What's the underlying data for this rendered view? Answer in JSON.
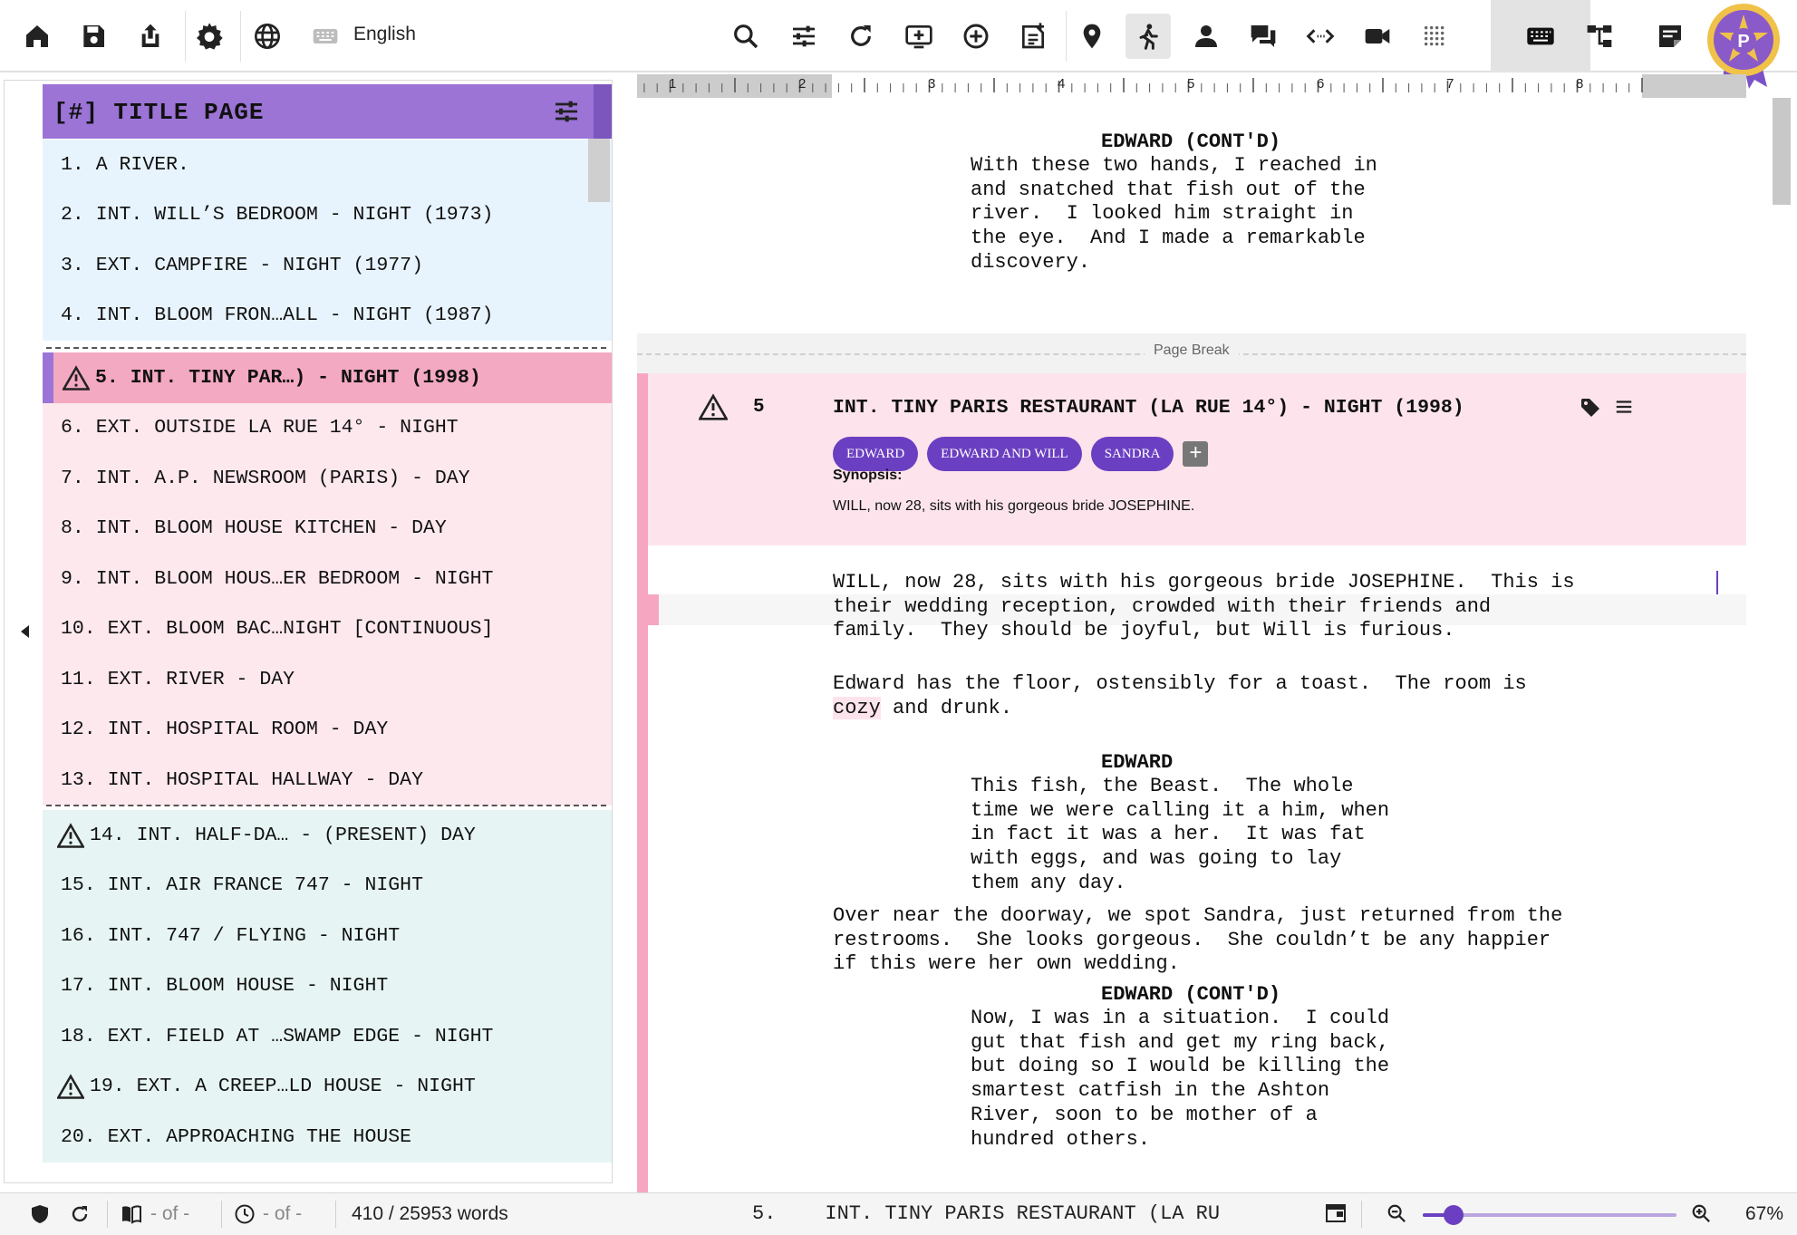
{
  "toolbar": {
    "language": "English",
    "icons": [
      "home-icon",
      "save-icon",
      "export-icon",
      "gear-icon",
      "globe-icon",
      "keyboard-small-icon",
      "search-icon",
      "sliders-icon",
      "refresh-icon",
      "add-scene-icon",
      "add-circle-icon",
      "add-note-icon",
      "location-pin-icon",
      "walking-figure-icon",
      "person-icon",
      "chat-icon",
      "code-arrows-icon",
      "video-camera-icon",
      "dot-grid-icon",
      "keyboard-icon",
      "tree-structure-icon",
      "sticky-note-icon"
    ],
    "avatar_letter": "P",
    "accent_color": "#9b74d6"
  },
  "navigator": {
    "title": "[#] TITLE PAGE",
    "groups": [
      {
        "color": "#e8f4fd",
        "scenes": [
          {
            "label": "1. A RIVER.",
            "warn": false
          },
          {
            "label": "2. INT. WILL’S BEDROOM - NIGHT (1973)",
            "warn": false
          },
          {
            "label": "3. EXT. CAMPFIRE - NIGHT (1977)",
            "warn": false
          },
          {
            "label": "4. INT. BLOOM FRON…ALL - NIGHT (1987)",
            "warn": false
          }
        ]
      },
      {
        "color": "#fde8ee",
        "scenes": [
          {
            "label": "5. INT. TINY PAR…) - NIGHT (1998)",
            "warn": true,
            "selected": true
          },
          {
            "label": "6. EXT. OUTSIDE LA RUE 14° - NIGHT",
            "warn": false
          },
          {
            "label": "7. INT. A.P. NEWSROOM (PARIS) - DAY",
            "warn": false
          },
          {
            "label": "8. INT. BLOOM HOUSE KITCHEN - DAY",
            "warn": false
          },
          {
            "label": "9. INT. BLOOM HOUS…ER BEDROOM - NIGHT",
            "warn": false
          },
          {
            "label": "10. EXT. BLOOM BAC…NIGHT [CONTINUOUS]",
            "warn": false
          },
          {
            "label": "11. EXT. RIVER - DAY",
            "warn": false
          },
          {
            "label": "12. INT. HOSPITAL ROOM - DAY",
            "warn": false
          },
          {
            "label": "13. INT. HOSPITAL HALLWAY - DAY",
            "warn": false
          }
        ]
      },
      {
        "color": "#e6f5f3",
        "scenes": [
          {
            "label": "14. INT. HALF-DA… - (PRESENT) DAY",
            "warn": true
          },
          {
            "label": "15. INT. AIR FRANCE 747 - NIGHT",
            "warn": false
          },
          {
            "label": "16. INT. 747 / FLYING - NIGHT",
            "warn": false
          },
          {
            "label": "17. INT. BLOOM HOUSE - NIGHT",
            "warn": false
          },
          {
            "label": "18. EXT. FIELD AT …SWAMP EDGE - NIGHT",
            "warn": false
          },
          {
            "label": "19. EXT. A CREEP…LD HOUSE - NIGHT",
            "warn": true
          },
          {
            "label": "20. EXT. APPROACHING THE HOUSE",
            "warn": false
          }
        ]
      }
    ]
  },
  "ruler": {
    "numbers": [
      "1",
      "2",
      "3",
      "4",
      "5",
      "6",
      "7",
      "8"
    ]
  },
  "editor": {
    "top_character": "EDWARD (CONT'D)",
    "top_dialogue": [
      "With these two hands, I reached in",
      "and snatched that fish out of the",
      "river.  I looked him straight in",
      "the eye.  And I made a remarkable",
      "discovery."
    ],
    "page_break_label": "Page Break",
    "scene": {
      "number": "5",
      "heading": "INT. TINY PARIS RESTAURANT (LA RUE 14°) - NIGHT (1998)",
      "chips": [
        "EDWARD",
        "EDWARD AND WILL",
        "SANDRA"
      ],
      "chip_add": "+",
      "synopsis_label": "Synopsis:",
      "synopsis": "WILL, now 28, sits with his gorgeous bride JOSEPHINE."
    },
    "action1": [
      "WILL, now 28, sits with his gorgeous bride JOSEPHINE.  This is",
      "their wedding reception, crowded with their friends and",
      "family.  They should be joyful, but Will is furious."
    ],
    "action2_line1": "Edward has the floor, ostensibly for a toast.  The room is",
    "action2_highlight": "cozy",
    "action2_rest": " and drunk.",
    "char2": "EDWARD",
    "dialogue2": [
      "This fish, the Beast.  The whole",
      "time we were calling it a him, when",
      "in fact it was a her.  It was fat",
      "with eggs, and was going to lay",
      "them any day."
    ],
    "action3": [
      "Over near the doorway, we spot Sandra, just returned from the",
      "restrooms.  She looks gorgeous.  She couldn’t be any happier",
      "if this were her own wedding."
    ],
    "char3": "EDWARD (CONT'D)",
    "dialogue3": [
      "Now, I was in a situation.  I could",
      "gut that fish and get my ring back,",
      "but doing so I would be killing the",
      "smartest catfish in the Ashton",
      "River, soon to be mother of a",
      "hundred others."
    ]
  },
  "status": {
    "pages_label": "- of -",
    "time_label": "- of -",
    "words": "410 / 25953 words",
    "scene_number": "5.",
    "scene_heading": "INT. TINY PARIS RESTAURANT (LA RU",
    "zoom_percent": "67%",
    "zoom_fraction": 0.12
  }
}
